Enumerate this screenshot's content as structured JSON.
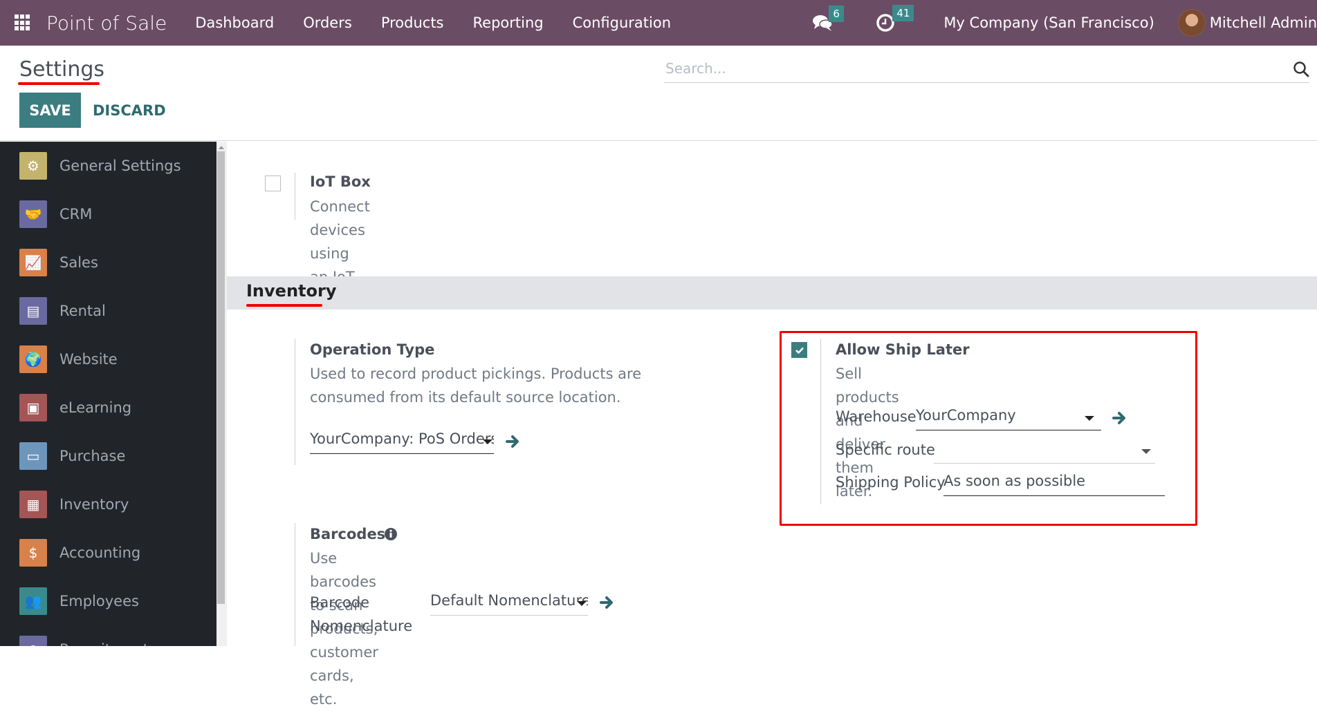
{
  "navbar": {
    "app_title": "Point of Sale",
    "menu": [
      "Dashboard",
      "Orders",
      "Products",
      "Reporting",
      "Configuration"
    ],
    "messages_count": "6",
    "activities_count": "41",
    "company": "My Company (San Francisco)",
    "user": "Mitchell Admin",
    "colors": {
      "bar": "#6b4c65",
      "badge": "#3a8a8c"
    }
  },
  "control_panel": {
    "title": "Settings",
    "save_label": "SAVE",
    "discard_label": "DISCARD",
    "search_placeholder": "Search..."
  },
  "sidebar": {
    "items": [
      {
        "label": "General Settings",
        "icon": "gear-icon",
        "color": "#c4b36c"
      },
      {
        "label": "CRM",
        "icon": "handshake-icon",
        "color": "#6b6aa0"
      },
      {
        "label": "Sales",
        "icon": "chart-line-icon",
        "color": "#d9814a"
      },
      {
        "label": "Rental",
        "icon": "calendar-icon",
        "color": "#6b6aa0"
      },
      {
        "label": "Website",
        "icon": "globe-icon",
        "color": "#d9814a"
      },
      {
        "label": "eLearning",
        "icon": "presentation-icon",
        "color": "#a45555"
      },
      {
        "label": "Purchase",
        "icon": "credit-card-icon",
        "color": "#6d96bd"
      },
      {
        "label": "Inventory",
        "icon": "box-icon",
        "color": "#a45555"
      },
      {
        "label": "Accounting",
        "icon": "invoice-icon",
        "color": "#d9814a"
      },
      {
        "label": "Employees",
        "icon": "users-icon",
        "color": "#3a8a8c"
      },
      {
        "label": "Recruitment",
        "icon": "recruitment-icon",
        "color": "#6b6aa0"
      }
    ]
  },
  "content": {
    "iot_box": {
      "title": "IoT Box",
      "description": "Connect devices using an IoT Box",
      "checked": false
    },
    "inventory_section": {
      "title": "Inventory"
    },
    "operation_type": {
      "title": "Operation Type",
      "description": "Used to record product pickings. Products are consumed from its default source location.",
      "value": "YourCompany: PoS Orders"
    },
    "allow_ship_later": {
      "title": "Allow Ship Later",
      "description": "Sell products and deliver them later.",
      "checked": true,
      "warehouse_label": "Warehouse",
      "warehouse_value": "YourCompany",
      "route_label": "Specific route",
      "route_value": "",
      "policy_label": "Shipping Policy",
      "policy_value": "As soon as possible"
    },
    "barcodes": {
      "title": "Barcodes",
      "description": "Use barcodes to scan products, customer cards, etc.",
      "nomenclature_label": "Barcode Nomenclature",
      "nomenclature_value": "Default Nomenclature"
    }
  },
  "annotation_color": "#ef0000"
}
